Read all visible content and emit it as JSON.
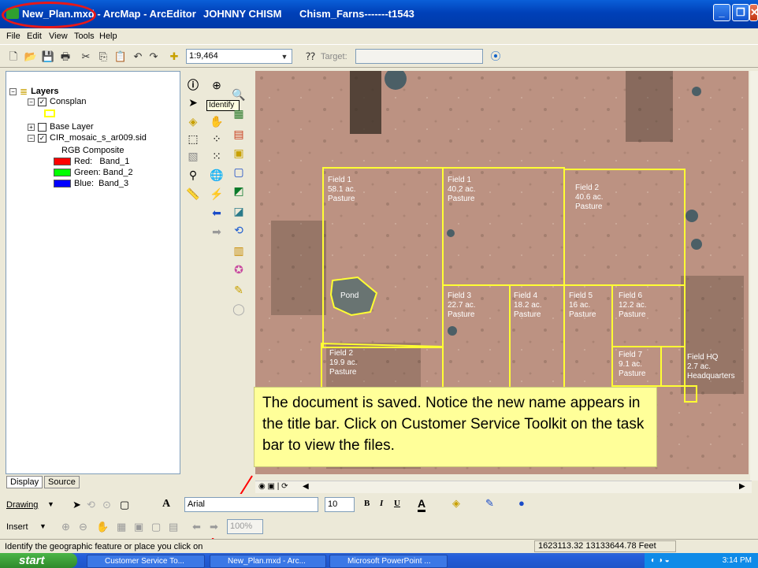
{
  "title": {
    "doc": "New_Plan.mxd - ArcMap - ArcEditor",
    "user": "JOHNNY CHISM",
    "project": "Chism_Farns-------t1543",
    "minimize": "_",
    "maximize": "❐",
    "close": "✕"
  },
  "menu": [
    "File",
    "Edit",
    "View",
    "Tools",
    "Help"
  ],
  "toolbar": {
    "scale": "1:9,464",
    "target_label": "Target:",
    "target_value": ""
  },
  "toc": {
    "root": "Layers",
    "layers": [
      {
        "name": "Consplan",
        "checked": true
      },
      {
        "name": "Base Layer",
        "checked": false
      },
      {
        "name": "CIR_mosaic_s_ar009.sid",
        "checked": true
      }
    ],
    "rgb": "RGB Composite",
    "bands": [
      {
        "label": "Red:   Band_1",
        "color": "#ff0000"
      },
      {
        "label": "Green: Band_2",
        "color": "#00ff00"
      },
      {
        "label": "Blue:  Band_3",
        "color": "#0000ff"
      }
    ],
    "consplan_swatch": "#ffff00",
    "tab_display": "Display",
    "tab_source": "Source"
  },
  "tooltip": "Identify",
  "fields": [
    {
      "name": "Field 1",
      "area": "58.1 ac.",
      "use": "Pasture"
    },
    {
      "name": "Field 1",
      "area": "40.2 ac.",
      "use": "Pasture"
    },
    {
      "name": "Field 2",
      "area": "40.6 ac.",
      "use": "Pasture"
    },
    {
      "name": "Pond"
    },
    {
      "name": "Field 3",
      "area": "22.7 ac.",
      "use": "Pasture"
    },
    {
      "name": "Field 4",
      "area": "18.2 ac.",
      "use": "Pasture"
    },
    {
      "name": "Field 5",
      "area": "16 ac.",
      "use": "Pasture"
    },
    {
      "name": "Field 6",
      "area": "12.2 ac.",
      "use": "Pasture"
    },
    {
      "name": "Field 2",
      "area": "19.9 ac.",
      "use": "Pasture"
    },
    {
      "name": "Field 7",
      "area": "9.1 ac.",
      "use": "Pasture"
    },
    {
      "name": "Field HQ",
      "area": "2.7 ac.",
      "use": "Headquarters"
    }
  ],
  "callout": "The document is saved. Notice the new name appears in the title bar. Click on Customer Service Toolkit on the task bar to view the files.",
  "draw": {
    "drawing": "Drawing",
    "font": "Arial",
    "size": "10",
    "bold": "B",
    "italic": "I",
    "underline": "U",
    "font_color": "A"
  },
  "insert": {
    "label": "Insert",
    "zoom": "100%"
  },
  "status": {
    "message": "Identify the geographic feature or place you click on",
    "coords": "1623113.32  13133644.78 Feet"
  },
  "taskbar": {
    "start": "start",
    "tasks": [
      "Customer Service To...",
      "New_Plan.mxd - Arc...",
      "Microsoft PowerPoint ..."
    ],
    "time": "3:14 PM"
  },
  "colors": {
    "field_outline": "#ffff33",
    "callout_bg": "#ffff99",
    "highlight": "#ff0000"
  }
}
